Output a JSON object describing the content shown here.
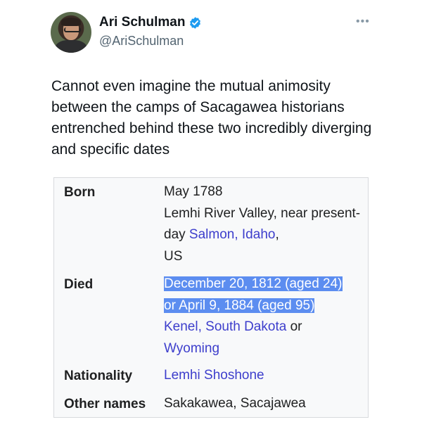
{
  "tweet": {
    "author_name": "Ari Schulman",
    "handle": "@AriSchulman",
    "more_icon": "more-horizontal-icon",
    "verified_icon": "verified-badge-icon",
    "verified_color": "#1d9bf0",
    "text": "Cannot even imagine the mutual animosity between the camps of Sacagawea historians entrenched behind these two incredibly diverging and specific dates"
  },
  "infobox": {
    "born_label": "Born",
    "born_date": "May 1788",
    "born_place_plain": "Lemhi River Valley, near present-day ",
    "born_place_link": "Salmon, Idaho",
    "born_place_suffix": ",",
    "born_country": "US",
    "died_label": "Died",
    "died_line1": "December 20, 1812 (aged 24)",
    "died_line2": "or April 9, 1884 (aged 95)",
    "died_place_link1": "Kenel, South Dakota",
    "died_place_or": " or",
    "died_place_link2": "Wyoming",
    "nationality_label": "Nationality",
    "nationality_link": "Lemhi Shoshone",
    "other_names_label": "Other names",
    "other_names_value": "Sakakawea, Sacajawea"
  },
  "colors": {
    "link": "#3d3ecc",
    "highlight": "#5c8df0",
    "infobox_bg": "#f8f9fa"
  }
}
